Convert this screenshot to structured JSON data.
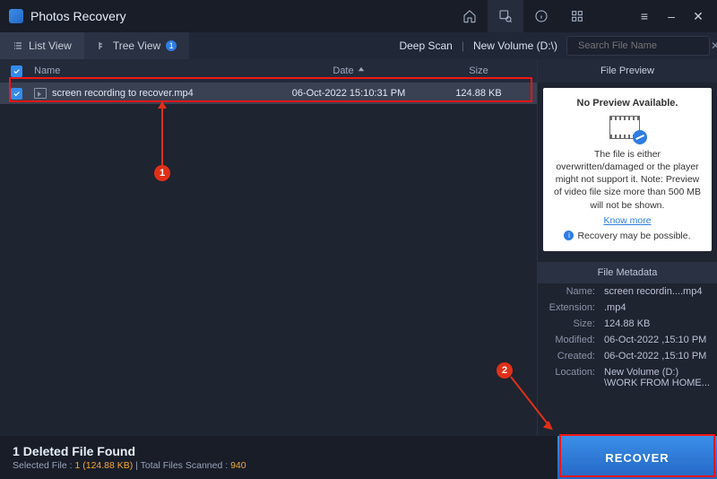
{
  "app": {
    "title": "Photos Recovery"
  },
  "toolbar": {
    "list_view": "List View",
    "tree_view": "Tree View",
    "tree_badge": "1",
    "deep_scan": "Deep Scan",
    "volume": "New Volume (D:\\)",
    "search_placeholder": "Search File Name"
  },
  "columns": {
    "name": "Name",
    "date": "Date",
    "size": "Size"
  },
  "file": {
    "name": "screen recording to recover.mp4",
    "date": "06-Oct-2022 15:10:31 PM",
    "size": "124.88 KB"
  },
  "preview": {
    "header": "File Preview",
    "no_preview": "No Preview Available.",
    "msg": "The file is either overwritten/damaged or the player might not support it. Note: Preview of video file size more than 500 MB will not be shown.",
    "know_more": "Know more",
    "recovery_possible": "Recovery may be possible."
  },
  "meta": {
    "header": "File Metadata",
    "name_k": "Name:",
    "name_v": "screen recordin....mp4",
    "ext_k": "Extension:",
    "ext_v": ".mp4",
    "size_k": "Size:",
    "size_v": "124.88 KB",
    "mod_k": "Modified:",
    "mod_v": "06-Oct-2022 ,15:10 PM",
    "cre_k": "Created:",
    "cre_v": "06-Oct-2022 ,15:10 PM",
    "loc_k": "Location:",
    "loc_v": "New Volume (D:) \\WORK FROM HOME..."
  },
  "footer": {
    "count": "1",
    "found": "Deleted File Found",
    "selected_label": "Selected File :",
    "selected_count": "1",
    "selected_size": "(124.88 KB)",
    "sep": " | ",
    "scanned_label": "Total Files Scanned :",
    "scanned_count": "940",
    "recover": "RECOVER"
  },
  "callouts": {
    "one": "1",
    "two": "2"
  }
}
